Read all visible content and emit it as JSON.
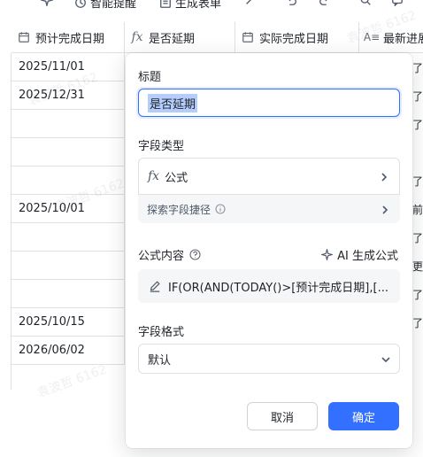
{
  "toolbar": {
    "smart_remind": "智能提醒",
    "create_form": "生成表单"
  },
  "table": {
    "columns": [
      {
        "icon": "calendar-icon",
        "label": "预计完成日期"
      },
      {
        "icon": "formula-icon",
        "label": "是否延期"
      },
      {
        "icon": "calendar-icon",
        "label": "实际完成日期"
      },
      {
        "icon": "text-icon",
        "label": "最新进展"
      }
    ],
    "dates": [
      "2025/11/01",
      "2025/12/31",
      "",
      "",
      "",
      "2025/10/01",
      "",
      "",
      "",
      "2025/10/15",
      "2026/06/02"
    ],
    "right_snippets": [
      "旗了",
      "省了",
      "划了",
      "斤了",
      "行前",
      "针了",
      "包更",
      "成了",
      "布了",
      "",
      ""
    ]
  },
  "panel": {
    "title_label": "标题",
    "title_value": "是否延期",
    "field_type_label": "字段类型",
    "field_type_value": "公式",
    "explore_shortcut": "探索字段捷径",
    "formula_label": "公式内容",
    "ai_generate": "AI 生成公式",
    "formula_text": "IF(OR(AND(TODAY()>[预计完成日期],[...",
    "format_label": "字段格式",
    "format_value": "默认",
    "cancel": "取消",
    "confirm": "确定"
  },
  "watermark": "袁波哲 6162"
}
